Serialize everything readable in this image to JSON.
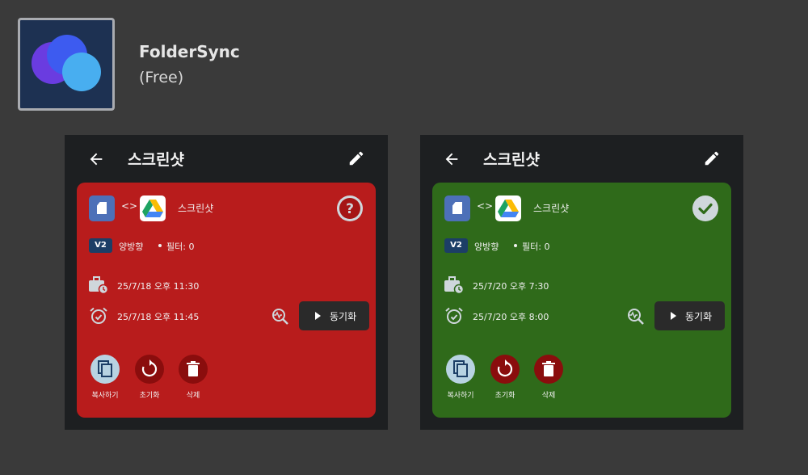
{
  "app": {
    "name": "FolderSync",
    "price": "(Free)",
    "icon": "foldersync-logo-icon"
  },
  "colors": {
    "card_error": "#b81c1c",
    "card_success": "#2f6a1a",
    "background": "#3a3a3a",
    "phone_bg": "#1d1f21"
  },
  "screens": [
    {
      "title": "스크린샷",
      "card": {
        "state": "unknown",
        "name": "스크린샷",
        "version": "V2",
        "sync_mode": "양방향",
        "filter": "필터: 0",
        "scheduled": "25/7/18 오후 11:30",
        "next_sync": "25/7/18 오후 11:45",
        "sync_button": "동기화",
        "actions": {
          "copy": "복사하기",
          "reset": "초기화",
          "delete": "삭제"
        }
      }
    },
    {
      "title": "스크린샷",
      "card": {
        "state": "success",
        "name": "스크린샷",
        "version": "V2",
        "sync_mode": "양방향",
        "filter": "필터: 0",
        "scheduled": "25/7/20 오후 7:30",
        "next_sync": "25/7/20 오후 8:00",
        "sync_button": "동기화",
        "actions": {
          "copy": "복사하기",
          "reset": "초기화",
          "delete": "삭제"
        }
      }
    }
  ]
}
